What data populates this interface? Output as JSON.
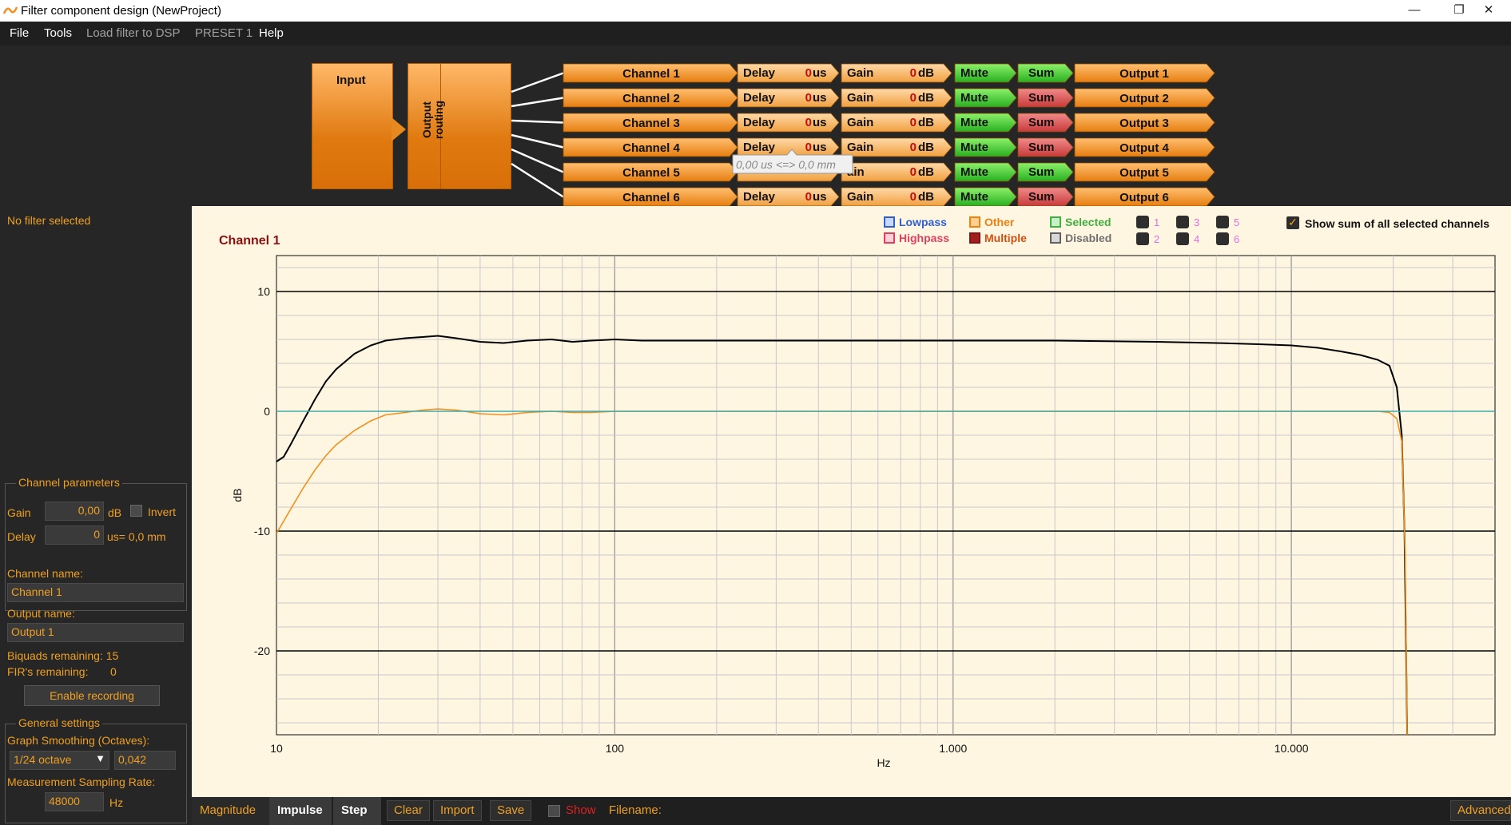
{
  "window": {
    "title": "Filter component design (NewProject)",
    "minimize": "—",
    "maximize": "❐",
    "close": "✕"
  },
  "menu": [
    "File",
    "Tools",
    "Load filter to DSP",
    "PRESET 1",
    "Help"
  ],
  "routing": {
    "input_label": "Input",
    "output_routing_label": "Output routing",
    "channels": [
      {
        "name": "Channel 1",
        "delay_label": "Delay",
        "delay_value": "0",
        "delay_unit": "us",
        "gain_label": "Gain",
        "gain_value": "0",
        "gain_unit": "dB",
        "mute": "Mute",
        "sum": "Sum",
        "sum_on": true,
        "output": "Output 1"
      },
      {
        "name": "Channel 2",
        "delay_label": "Delay",
        "delay_value": "0",
        "delay_unit": "us",
        "gain_label": "Gain",
        "gain_value": "0",
        "gain_unit": "dB",
        "mute": "Mute",
        "sum": "Sum",
        "sum_on": false,
        "output": "Output 2"
      },
      {
        "name": "Channel 3",
        "delay_label": "Delay",
        "delay_value": "0",
        "delay_unit": "us",
        "gain_label": "Gain",
        "gain_value": "0",
        "gain_unit": "dB",
        "mute": "Mute",
        "sum": "Sum",
        "sum_on": false,
        "output": "Output 3"
      },
      {
        "name": "Channel 4",
        "delay_label": "Delay",
        "delay_value": "0",
        "delay_unit": "us",
        "gain_label": "Gain",
        "gain_value": "0",
        "gain_unit": "dB",
        "mute": "Mute",
        "sum": "Sum",
        "sum_on": false,
        "output": "Output 4"
      },
      {
        "name": "Channel 5",
        "delay_label": "",
        "delay_value": "",
        "delay_unit": "",
        "gain_label": "ain",
        "gain_value": "0",
        "gain_unit": "dB",
        "mute": "Mute",
        "sum": "Sum",
        "sum_on": true,
        "output": "Output 5"
      },
      {
        "name": "Channel 6",
        "delay_label": "Delay",
        "delay_value": "0",
        "delay_unit": "us",
        "gain_label": "Gain",
        "gain_value": "0",
        "gain_unit": "dB",
        "mute": "Mute",
        "sum": "Sum",
        "sum_on": false,
        "output": "Output 6"
      }
    ],
    "tooltip": "0,00 us <=> 0,0 mm"
  },
  "left_panel": {
    "no_filter": "No filter selected",
    "channel_params_title": "Channel parameters",
    "gain_label": "Gain",
    "gain_value": "0,00",
    "gain_unit": "dB",
    "invert_label": "Invert",
    "delay_label": "Delay",
    "delay_value": "0",
    "delay_unit": "us= 0,0 mm",
    "channel_name_label": "Channel name:",
    "channel_name_value": "Channel 1",
    "output_name_label": "Output name:",
    "output_name_value": "Output 1",
    "biquads": "Biquads remaining: 15",
    "firs_label": "FIR's remaining:",
    "firs_value": "0",
    "enable_recording": "Enable recording",
    "general_title": "General settings",
    "smoothing_label": "Graph Smoothing (Octaves):",
    "smoothing_select": "1/24 octave",
    "smoothing_value": "0,042",
    "sampling_label": "Measurement Sampling Rate:",
    "sampling_value": "48000",
    "sampling_unit": "Hz"
  },
  "legend": {
    "lowpass": "Lowpass",
    "highpass": "Highpass",
    "other": "Other",
    "multiple": "Multiple",
    "selected": "Selected",
    "disabled": "Disabled",
    "numbers": [
      "1",
      "2",
      "3",
      "4",
      "5",
      "6"
    ],
    "show_sum": "Show sum of all selected channels",
    "colors": {
      "lowpass": "#3060d0",
      "highpass": "#e04060",
      "other": "#f08010",
      "multiple": "#8b1010",
      "selected": "#40b040",
      "disabled": "#909090"
    }
  },
  "chart_data": {
    "type": "line",
    "title": "Channel 1",
    "xlabel": "Hz",
    "ylabel": "dB",
    "xscale": "log",
    "xlim": [
      10,
      40000
    ],
    "ylim": [
      -27,
      13
    ],
    "x_ticks": [
      {
        "v": 10,
        "label": "10"
      },
      {
        "v": 100,
        "label": "100"
      },
      {
        "v": 1000,
        "label": "1.000"
      },
      {
        "v": 10000,
        "label": "10.000"
      }
    ],
    "y_ticks": [
      {
        "v": 10,
        "label": "10"
      },
      {
        "v": 0,
        "label": "0"
      },
      {
        "v": -10,
        "label": "-10"
      },
      {
        "v": -20,
        "label": "-20"
      }
    ],
    "series": [
      {
        "color": "#000000",
        "x": [
          10,
          10.5,
          11,
          12,
          13,
          14,
          15,
          17,
          19,
          21,
          24,
          27,
          30,
          34,
          40,
          47,
          55,
          65,
          75,
          85,
          100,
          120,
          150,
          200,
          300,
          500,
          1000,
          2000,
          4000,
          6000,
          8000,
          10000,
          12000,
          14000,
          16000,
          18000,
          19500,
          20500,
          21200,
          21600,
          22000
        ],
        "y": [
          -4.2,
          -3.8,
          -2.8,
          -0.8,
          1.0,
          2.5,
          3.5,
          4.8,
          5.5,
          5.9,
          6.1,
          6.2,
          6.3,
          6.1,
          5.8,
          5.7,
          5.9,
          6.0,
          5.8,
          5.9,
          6.0,
          5.9,
          5.9,
          5.9,
          5.9,
          5.9,
          5.9,
          5.9,
          5.8,
          5.7,
          5.6,
          5.5,
          5.3,
          5.0,
          4.7,
          4.3,
          3.8,
          2.0,
          -2.0,
          -10.0,
          -27.0
        ]
      },
      {
        "color": "#f09020",
        "x": [
          10,
          11,
          12,
          13,
          14,
          15,
          17,
          19,
          21,
          24,
          27,
          30,
          34,
          40,
          47,
          55,
          65,
          75,
          85,
          100,
          120,
          150,
          200,
          500,
          1000,
          5000,
          10000,
          15000,
          18000,
          19500,
          20500,
          21200,
          21700,
          22000
        ],
        "y": [
          -10.2,
          -8.2,
          -6.4,
          -4.9,
          -3.7,
          -2.8,
          -1.6,
          -0.8,
          -0.3,
          -0.1,
          0.1,
          0.2,
          0.1,
          -0.2,
          -0.3,
          -0.1,
          0.0,
          -0.1,
          -0.1,
          0.0,
          0.0,
          0.0,
          0.0,
          0.0,
          0.0,
          0.0,
          0.0,
          0.0,
          0.0,
          -0.1,
          -0.6,
          -2.5,
          -12.0,
          -27.0
        ]
      },
      {
        "color": "#40a8a8",
        "x": [
          10,
          40000
        ],
        "y": [
          0,
          0
        ]
      }
    ]
  },
  "bottom": {
    "tabs": [
      "Magnitude",
      "Impulse",
      "Step"
    ],
    "buttons": [
      "Clear",
      "Import",
      "Save"
    ],
    "show": "Show",
    "filename": "Filename:",
    "advanced": "Advanced"
  }
}
